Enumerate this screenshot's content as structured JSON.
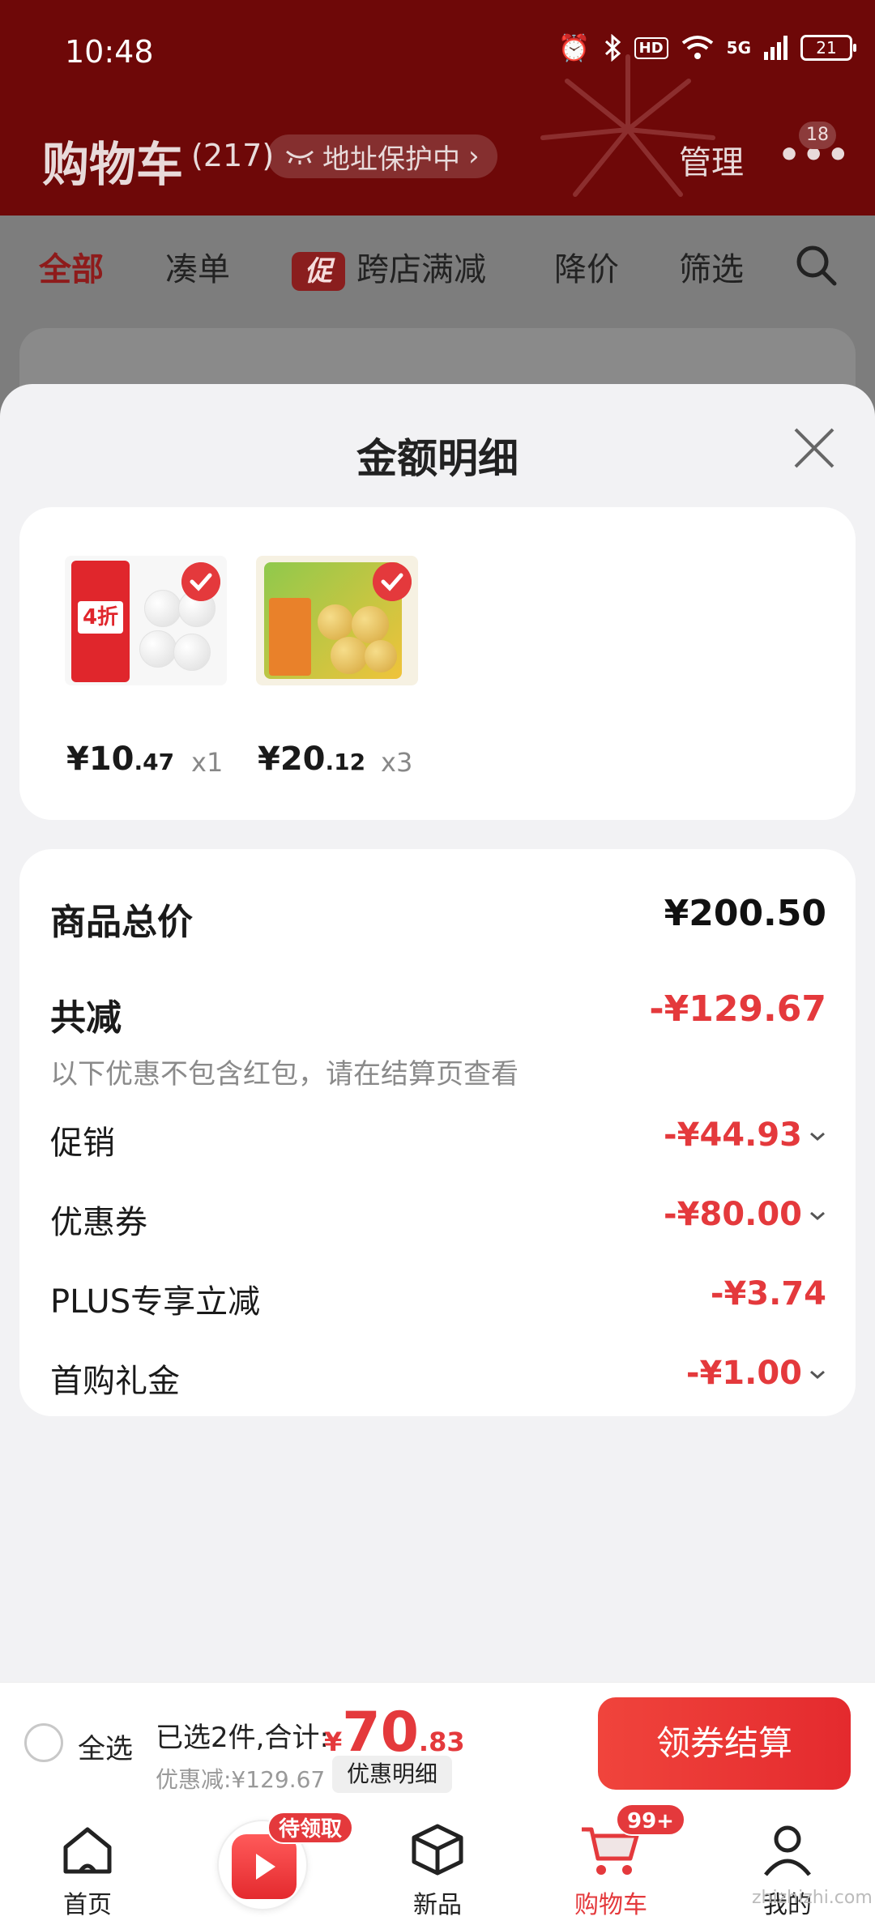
{
  "status_bar": {
    "time": "10:48",
    "battery": "21",
    "network": "5G",
    "hd": "HD"
  },
  "header": {
    "title": "购物车",
    "count": "(217)",
    "address_protect": "地址保护中",
    "manage": "管理",
    "more_badge": "18"
  },
  "filters": {
    "all": "全部",
    "combo": "凑单",
    "promo_tag": "促",
    "cross_store": "跨店满减",
    "price_drop": "降价",
    "filter": "筛选"
  },
  "sheet": {
    "title": "金额明细",
    "items": [
      {
        "price_yen": "¥",
        "price_int": "10",
        "price_dec": ".47",
        "qty": "x1",
        "thumb_badge": "4折"
      },
      {
        "price_yen": "¥",
        "price_int": "20",
        "price_dec": ".12",
        "qty": "x3"
      }
    ],
    "total_label": "商品总价",
    "total_value": "¥200.50",
    "reduce_label": "共减",
    "reduce_value": "-¥129.67",
    "note": "以下优惠不包含红包，请在结算页查看",
    "rows": [
      {
        "label": "促销",
        "value": "-¥44.93"
      },
      {
        "label": "优惠券",
        "value": "-¥80.00"
      },
      {
        "label": "PLUS专享立减",
        "value": "-¥3.74"
      },
      {
        "label": "首购礼金",
        "value": "-¥1.00"
      }
    ]
  },
  "checkout": {
    "select_all": "全选",
    "selected": "已选2件,合计:",
    "total_yen": "¥",
    "total_int": "70",
    "total_dec": ".83",
    "discount": "优惠减:¥129.67",
    "detail_button": "优惠明细",
    "pay_button": "领券结算"
  },
  "nav": {
    "home": "首页",
    "center_badge": "待领取",
    "new": "新品",
    "cart": "购物车",
    "cart_badge": "99+",
    "mine": "我的"
  },
  "watermark": "zhizhizhi.com",
  "colors": {
    "accent": "#e4393c",
    "header_bg": "#6e0808"
  }
}
